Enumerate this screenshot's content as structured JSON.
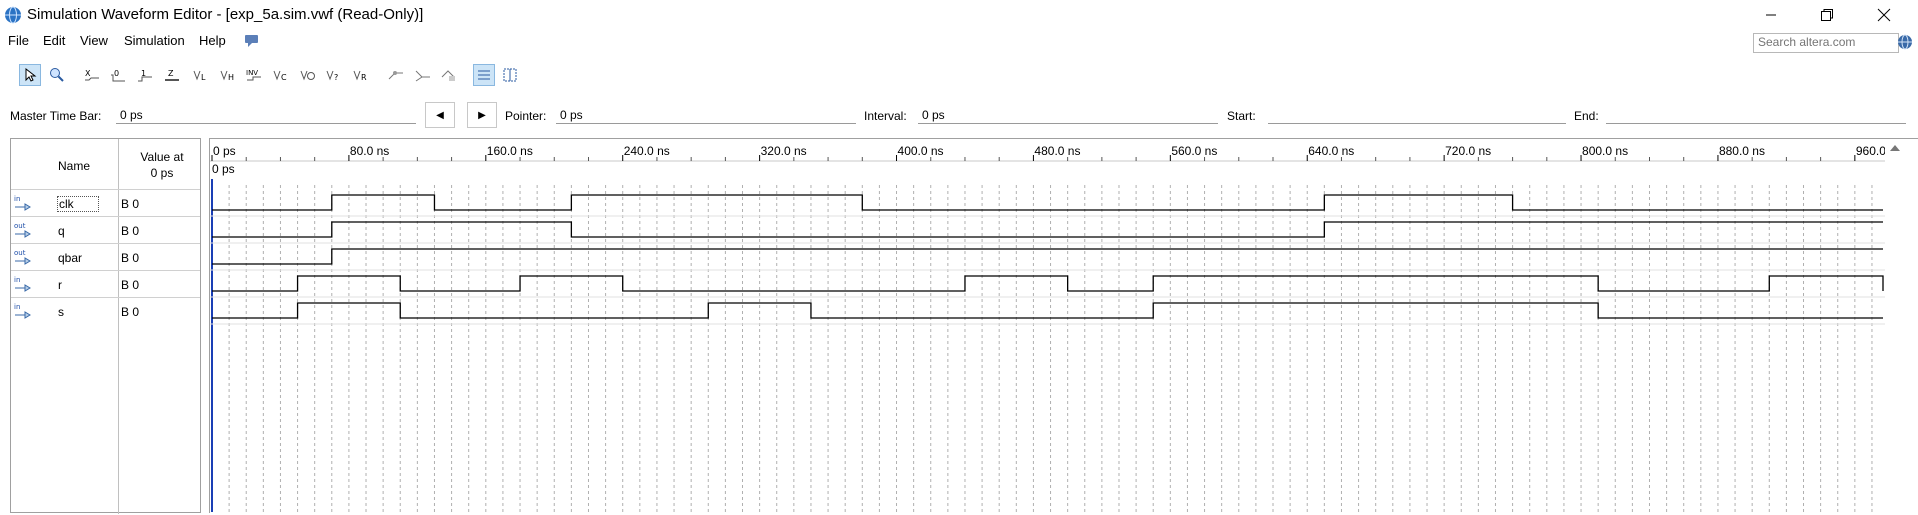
{
  "window": {
    "title": "Simulation Waveform Editor - [exp_5a.sim.vwf (Read-Only)]",
    "controls": [
      "minimize",
      "restore",
      "close"
    ]
  },
  "menu": {
    "items": [
      "File",
      "Edit",
      "View",
      "Simulation",
      "Help"
    ],
    "search_placeholder": "Search altera.com"
  },
  "toolbar": {
    "icons": [
      "selection-tool-icon",
      "zoom-tool-icon",
      "unknown-value-icon",
      "forcing-low-icon",
      "forcing-high-icon",
      "high-impedance-icon",
      "weak-low-icon",
      "weak-high-icon",
      "invert-icon",
      "count-value-icon",
      "clock-icon",
      "random-values-icon",
      "arbitrary-value-icon",
      "snap-to-grid-icon",
      "group-icon",
      "ungroup-icon",
      "reverse-group-icon",
      "sort-icon",
      "grid-settings-icon"
    ]
  },
  "timebar": {
    "master_label": "Master Time Bar:",
    "master_value": "0 ps",
    "pointer_label": "Pointer:",
    "pointer_value": "0 ps",
    "interval_label": "Interval:",
    "interval_value": "0 ps",
    "start_label": "Start:",
    "start_value": "",
    "end_label": "End:",
    "end_value": ""
  },
  "columns": {
    "name": "Name",
    "value_line1": "Value at",
    "value_line2": "0 ps"
  },
  "ruler": {
    "labels": [
      "0 ps",
      "80.0 ns",
      "160.0 ns",
      "240.0 ns",
      "320.0 ns",
      "400.0 ns",
      "480.0 ns",
      "560.0 ns",
      "640.0 ns",
      "720.0 ns",
      "800.0 ns",
      "880.0 ns",
      "960.0 ns"
    ],
    "cursor_label": "0 ps"
  },
  "signals": [
    {
      "dir": "in",
      "name": "clk",
      "value": "B 0",
      "edges_ns": [
        70,
        130,
        210,
        380,
        650,
        760
      ]
    },
    {
      "dir": "out",
      "name": "q",
      "value": "B 0",
      "edges_ns": [
        70,
        210,
        650
      ]
    },
    {
      "dir": "out",
      "name": "qbar",
      "value": "B 0",
      "edges_ns": [
        70
      ]
    },
    {
      "dir": "in",
      "name": "r",
      "value": "B 0",
      "edges_ns": [
        50,
        110,
        180,
        240,
        440,
        500,
        550,
        810,
        910,
        980
      ]
    },
    {
      "dir": "in",
      "name": "s",
      "value": "B 0",
      "edges_ns": [
        50,
        110,
        290,
        350,
        550,
        810
      ]
    }
  ],
  "colors": {
    "cursor": "#1a3fb5",
    "signal_line": "#000000",
    "grid_dash": "#b0b0b0"
  }
}
